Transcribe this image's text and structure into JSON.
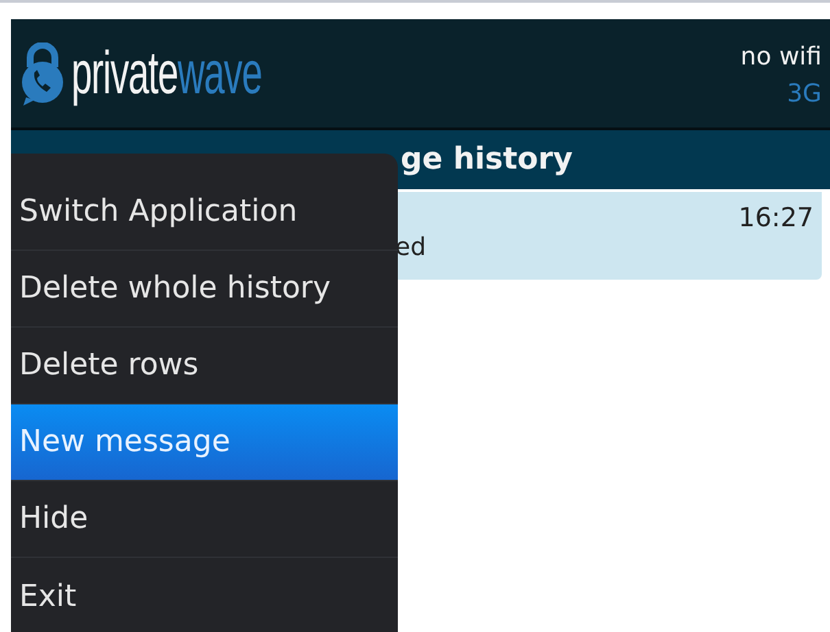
{
  "header": {
    "logo": {
      "first": "private",
      "second": "wave"
    },
    "wifi_status": "no wifi",
    "network": "3G"
  },
  "title_bar": {
    "title": "ge history"
  },
  "messages": [
    {
      "time": "16:27",
      "preview": "ed"
    }
  ],
  "menu": {
    "items": [
      {
        "label": "Switch Application",
        "selected": false
      },
      {
        "label": "Delete whole history",
        "selected": false
      },
      {
        "label": "Delete rows",
        "selected": false
      },
      {
        "label": "New message",
        "selected": true
      },
      {
        "label": "Hide",
        "selected": false
      },
      {
        "label": "Exit",
        "selected": false
      }
    ]
  }
}
